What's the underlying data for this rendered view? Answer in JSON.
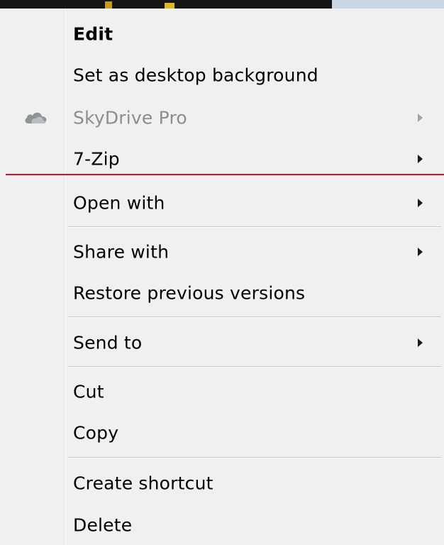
{
  "menu": {
    "items": [
      {
        "label": "Edit",
        "bold": true,
        "submenu": false,
        "disabled": false
      },
      {
        "label": "Set as desktop background",
        "bold": false,
        "submenu": false,
        "disabled": false
      },
      {
        "label": "SkyDrive Pro",
        "bold": false,
        "submenu": true,
        "disabled": true,
        "icon": "cloud-icon"
      },
      {
        "label": "7-Zip",
        "bold": false,
        "submenu": true,
        "disabled": false
      },
      {
        "label": "Open with",
        "bold": false,
        "submenu": true,
        "disabled": false
      },
      {
        "label": "Share with",
        "bold": false,
        "submenu": true,
        "disabled": false
      },
      {
        "label": "Restore previous versions",
        "bold": false,
        "submenu": false,
        "disabled": false
      },
      {
        "label": "Send to",
        "bold": false,
        "submenu": true,
        "disabled": false
      },
      {
        "label": "Cut",
        "bold": false,
        "submenu": false,
        "disabled": false
      },
      {
        "label": "Copy",
        "bold": false,
        "submenu": false,
        "disabled": false
      },
      {
        "label": "Create shortcut",
        "bold": false,
        "submenu": false,
        "disabled": false
      },
      {
        "label": "Delete",
        "bold": false,
        "submenu": false,
        "disabled": false
      }
    ]
  },
  "colors": {
    "menu_background": "#f0f0f0",
    "text": "#000000",
    "disabled_text": "#8d8d8d",
    "separator": "#c8c8c8",
    "highlight_line": "#d4161c"
  }
}
